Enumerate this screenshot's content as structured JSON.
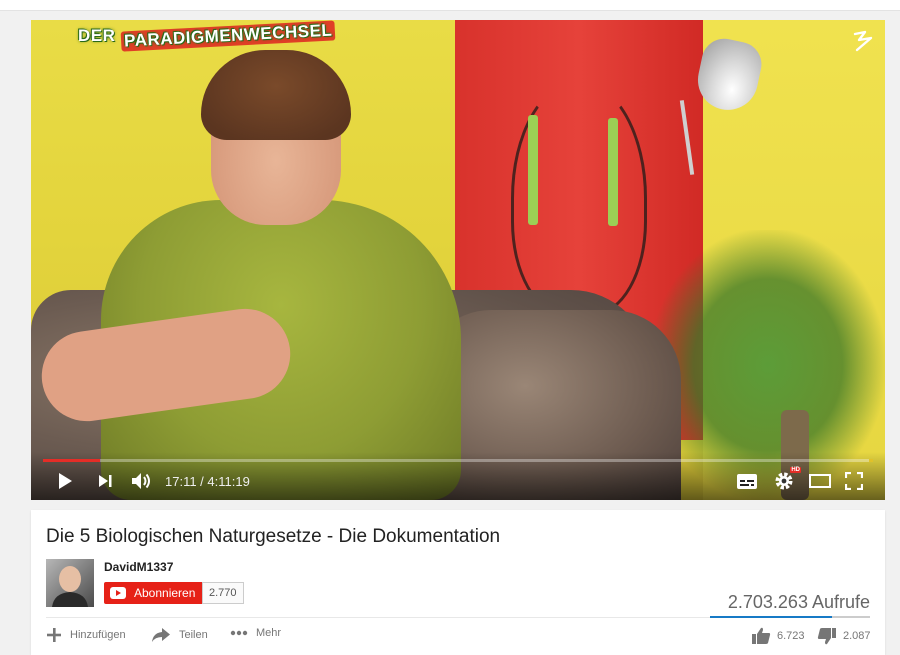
{
  "player": {
    "channel_logo_text_1": "DER ",
    "channel_logo_text_2": "PARADIGMENWECHSEL",
    "time_display": "17:11 / 4:11:19",
    "progress_fraction": 0.069,
    "icons": [
      "play-icon",
      "next-icon",
      "volume-icon",
      "subtitles-icon",
      "settings-icon",
      "theater-icon",
      "fullscreen-icon"
    ],
    "hd_badge": "HD"
  },
  "video": {
    "title": "Die 5 Biologischen Naturgesetze - Die Dokumentation",
    "channel": "DavidM1337",
    "subscribe_label": "Abonnieren",
    "subscriber_count": "2.770",
    "views": "2.703.263 Aufrufe",
    "like_ratio": 0.762
  },
  "actions": {
    "add_label": "Hinzufügen",
    "share_label": "Teilen",
    "more_label": "Mehr",
    "likes": "6.723",
    "dislikes": "2.087"
  },
  "colors": {
    "accent_red": "#e62117",
    "likes_blue": "#167ac6"
  }
}
